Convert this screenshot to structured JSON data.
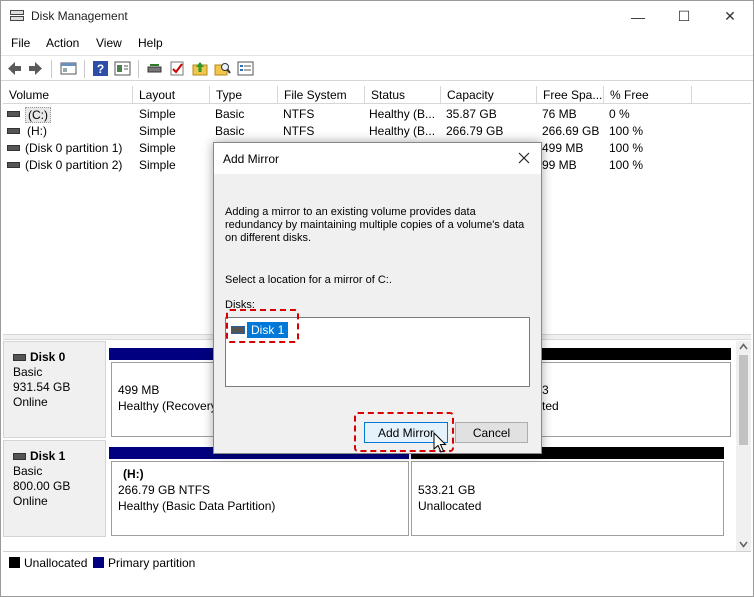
{
  "window": {
    "title": "Disk Management"
  },
  "window_controls": {
    "minimize": "—",
    "maximize": "☐",
    "close": "✕"
  },
  "menu": [
    "File",
    "Action",
    "View",
    "Help"
  ],
  "volume_list": {
    "columns": [
      "Volume",
      "Layout",
      "Type",
      "File System",
      "Status",
      "Capacity",
      "Free Spa...",
      "% Free"
    ],
    "rows": [
      {
        "volume": "(C:)",
        "layout": "Simple",
        "type": "Basic",
        "fs": "NTFS",
        "status": "Healthy (B...",
        "capacity": "35.87 GB",
        "free": "76 MB",
        "pct": "0 %"
      },
      {
        "volume": "(H:)",
        "layout": "Simple",
        "type": "Basic",
        "fs": "NTFS",
        "status": "Healthy (B...",
        "capacity": "266.79 GB",
        "free": "266.69 GB",
        "pct": "100 %"
      },
      {
        "volume": "(Disk 0 partition 1)",
        "layout": "Simple",
        "type": "",
        "fs": "",
        "status": "",
        "capacity": "",
        "free": "499 MB",
        "pct": "100 %"
      },
      {
        "volume": "(Disk 0 partition 2)",
        "layout": "Simple",
        "type": "",
        "fs": "",
        "status": "",
        "capacity": "",
        "free": "99 MB",
        "pct": "100 %"
      }
    ]
  },
  "disks": [
    {
      "name": "Disk 0",
      "type": "Basic",
      "size": "931.54 GB",
      "state": "Online",
      "partitions": [
        {
          "line1": "499 MB",
          "line2": "Healthy (Recovery"
        },
        {
          "line1": "3",
          "line2": "ted"
        }
      ]
    },
    {
      "name": "Disk 1",
      "type": "Basic",
      "size": "800.00 GB",
      "state": "Online",
      "partitions": [
        {
          "title": "(H:)",
          "line1": "266.79 GB NTFS",
          "line2": "Healthy (Basic Data Partition)"
        },
        {
          "line1": "533.21 GB",
          "line2": "Unallocated"
        }
      ]
    }
  ],
  "legend": [
    {
      "label": "Unallocated",
      "color": "#000000"
    },
    {
      "label": "Primary partition",
      "color": "#000080"
    }
  ],
  "dialog": {
    "title": "Add Mirror",
    "description": "Adding a mirror to an existing volume provides data redundancy by maintaining multiple copies of a volume's data on different disks.",
    "prompt": "Select a location for a mirror of C:.",
    "disks_label": "Disks:",
    "disks": [
      "Disk 1"
    ],
    "add_button": "Add Mirror",
    "cancel_button": "Cancel"
  },
  "colors": {
    "primary": "#000080",
    "unallocated": "#000000",
    "highlight": "#d80000",
    "selection": "#0078d7"
  }
}
